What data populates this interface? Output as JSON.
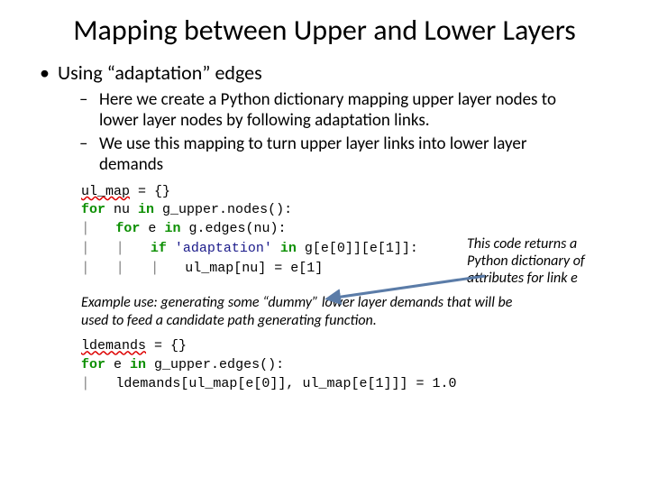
{
  "title": "Mapping between Upper and Lower Layers",
  "bullet1": "Using “adaptation” edges",
  "sub1": "Here we create a Python dictionary mapping upper layer nodes to lower layer nodes by following adaptation links.",
  "sub2": "We use this mapping to turn upper layer links into lower layer demands",
  "annotation": "This code returns a Python dictionary of attributes for link e",
  "code1": {
    "l1a": "ul_map",
    "l1b": " = {}",
    "l2a": "for",
    "l2b": " nu ",
    "l2c": "in",
    "l2d": " g_upper.nodes():",
    "l3a": "for",
    "l3b": " e ",
    "l3c": "in",
    "l3d": " g.edges(nu):",
    "l4a": "if",
    "l4b": "'adaptation'",
    "l4c": "in",
    "l4d": " g[e[0]][e[1]]:",
    "l5": "ul_map[nu] = e[1]"
  },
  "example_note": "Example use: generating some “dummy” lower layer demands that will be used to feed a candidate path generating function.",
  "code2": {
    "l1a": "ldemands",
    "l1b": " = {}",
    "l2a": "for",
    "l2b": " e ",
    "l2c": "in",
    "l2d": " g_upper.edges():",
    "l3": "ldemands[ul_map[e[0]], ul_map[e[1]]] = 1.0"
  }
}
